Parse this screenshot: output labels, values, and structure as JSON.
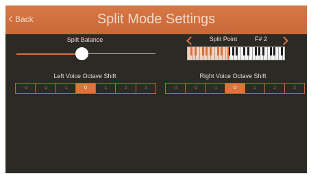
{
  "header": {
    "back_label": "Back",
    "title": "Split Mode Settings"
  },
  "split_balance": {
    "label": "Split Balance",
    "value": 0.47
  },
  "split_point": {
    "label": "Split Point",
    "value": "F# 2"
  },
  "left_voice": {
    "label": "Left Voice Octave Shift",
    "options": [
      "-3",
      "-2",
      "-1",
      "0",
      "1",
      "2",
      "3"
    ],
    "selected": "0"
  },
  "right_voice": {
    "label": "Right Voice Octave Shift",
    "options": [
      "-3",
      "-2",
      "-1",
      "0",
      "1",
      "2",
      "3"
    ],
    "selected": "0"
  },
  "colors": {
    "accent": "#e0733d",
    "header": "#cf6f3f",
    "background": "#2c2a25"
  },
  "icons": {
    "back": "chevron-left-icon",
    "prev": "chevron-left-icon",
    "next": "chevron-right-icon"
  }
}
